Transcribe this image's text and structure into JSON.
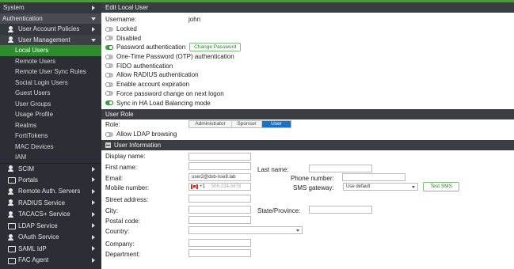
{
  "sidebar": {
    "system": "System",
    "authentication": "Authentication",
    "user_account_policies": "User Account Policies",
    "user_management": "User Management",
    "items": [
      "Local Users",
      "Remote Users",
      "Remote User Sync Rules",
      "Social Login Users",
      "Guest Users",
      "User Groups",
      "Usage Profile",
      "Realms",
      "FortiTokens",
      "MAC Devices",
      "IAM"
    ],
    "groups": [
      "SCIM",
      "Portals",
      "Remote Auth. Servers",
      "RADIUS Service",
      "TACACS+ Service",
      "LDAP Service",
      "OAuth Service",
      "SAML IdP",
      "FAC Agent"
    ]
  },
  "edit": {
    "header": "Edit Local User",
    "username_label": "Username:",
    "username_value": "john",
    "locked": "Locked",
    "disabled": "Disabled",
    "password_auth": "Password authentication",
    "change_password": "Change Password",
    "otp": "One-Time Password (OTP) authentication",
    "fido": "FIDO authentication",
    "radius": "Allow RADIUS authentication",
    "expiration": "Enable account expiration",
    "force_change": "Force password change on next logon",
    "sync_ha": "Sync in HA Load Balancing mode"
  },
  "role": {
    "header": "User Role",
    "label": "Role:",
    "options": [
      "Administrator",
      "Sponsor",
      "User"
    ],
    "selected": "User",
    "ldap": "Allow LDAP browsing"
  },
  "info": {
    "header": "User Information",
    "display_name": "Display name:",
    "first_name": "First name:",
    "last_name": "Last name:",
    "email": "Email:",
    "email_value": "user2@dxb-nse8.lab",
    "phone": "Phone number:",
    "mobile": "Mobile number:",
    "mobile_code": "+1",
    "mobile_placeholder": "506-234-5678",
    "sms_gateway": "SMS gateway:",
    "sms_value": "Use default",
    "test_sms": "Test SMS",
    "street": "Street address:",
    "city": "City:",
    "state": "State/Province:",
    "postal": "Postal code:",
    "country": "Country:",
    "company": "Company:",
    "department": "Department:"
  },
  "colors": {
    "accent": "#2e8b2e",
    "sidebar": "#2b2e34",
    "selected_role": "#1a72c2"
  }
}
